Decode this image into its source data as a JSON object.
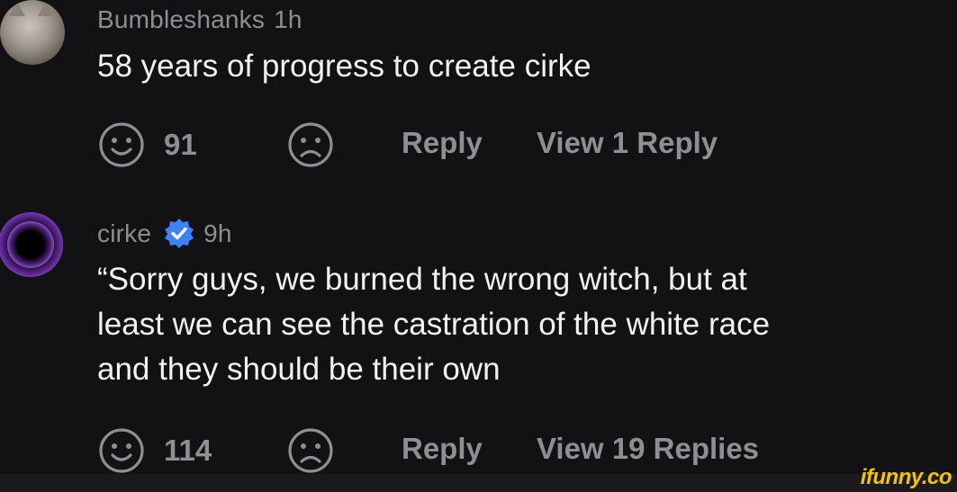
{
  "comments": [
    {
      "username": "Bumbleshanks",
      "time": "1h",
      "verified": false,
      "text_lines": [
        "58 years of progress to create cirke"
      ],
      "like_count": "91",
      "reply_label": "Reply",
      "view_replies_label": "View 1 Reply"
    },
    {
      "username": "cirke",
      "time": "9h",
      "verified": true,
      "text_lines": [
        "“Sorry guys, we burned the wrong witch, but at",
        "least we can see the castration of the white race",
        "and they should be their own"
      ],
      "like_count": "114",
      "reply_label": "Reply",
      "view_replies_label": "View 19 Replies"
    }
  ],
  "icons": {
    "smile": "smile-icon",
    "frown": "frown-icon",
    "verified": "verified-badge-icon"
  },
  "colors": {
    "background": "#121215",
    "text_primary": "#f2f2f2",
    "text_secondary": "#8e8e93",
    "verified_blue": "#3b82f6",
    "watermark": "#f5c400"
  },
  "watermark": "ifunny.co"
}
